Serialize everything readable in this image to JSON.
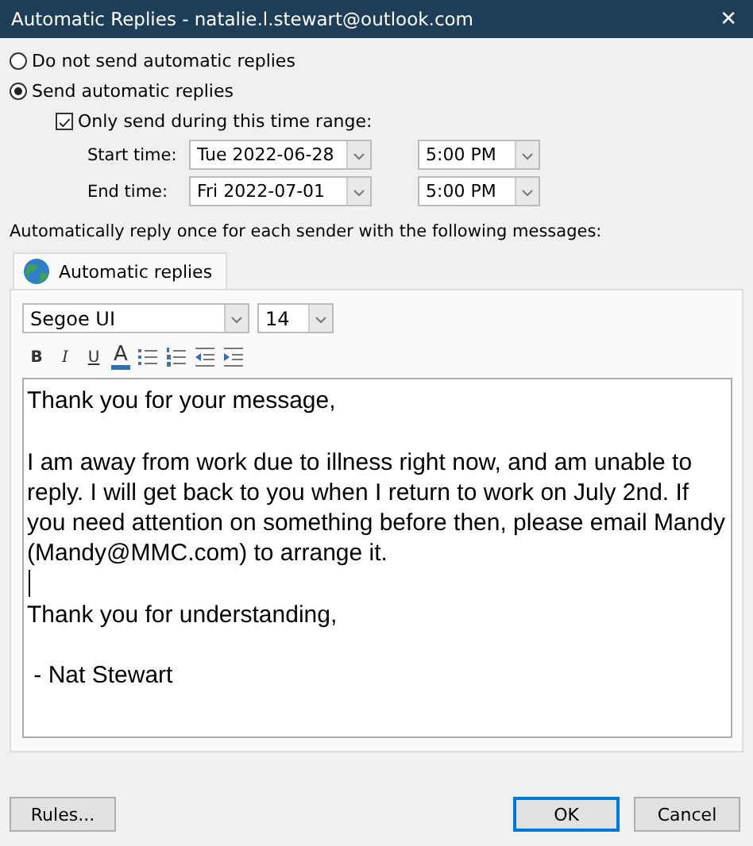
{
  "window": {
    "title": "Automatic Replies - natalie.l.stewart@outlook.com",
    "close": "✕"
  },
  "reply_mode": [
    {
      "label": "Do not send automatic replies",
      "selected": false
    },
    {
      "label": "Send automatic replies",
      "selected": true
    }
  ],
  "time_range": {
    "label": "Only send during this time range:",
    "checked": true,
    "rows": [
      {
        "label": "Start time:",
        "date": "Tue 2022-06-28",
        "time": "5:00 PM"
      },
      {
        "label": "End time:",
        "date": "Fri 2022-07-01",
        "time": "5:00 PM"
      }
    ]
  },
  "instruction": "Automatically reply once for each sender with the following messages:",
  "tabs": [
    {
      "label": "Automatic replies",
      "selected": true
    }
  ],
  "format": {
    "font": "Segoe UI",
    "size": "14",
    "buttons": [
      {
        "kind": "bold",
        "label": "B"
      },
      {
        "kind": "italic",
        "label": "I"
      },
      {
        "kind": "underline",
        "label": "U"
      },
      {
        "kind": "color",
        "label": "A"
      },
      {
        "kind": "bullets"
      },
      {
        "kind": "numbers"
      },
      {
        "kind": "outdent"
      },
      {
        "kind": "indent"
      }
    ]
  },
  "message": [
    {
      "text": "Thank you for your message,"
    },
    {
      "text": "I am away from work due to illness right now, and am unable to reply. I will get back to you when I return to work on July 2nd. If you need attention on something before then, please email Mandy (Mandy@MMC.com) to arrange it.",
      "cursor_after": true
    },
    {
      "text": "Thank you for understanding,"
    },
    {
      "text": " - Nat Stewart"
    }
  ],
  "buttons": [
    {
      "label": "Rules...",
      "default": false
    },
    {
      "label": "OK",
      "default": true
    },
    {
      "label": "Cancel",
      "default": false
    }
  ]
}
